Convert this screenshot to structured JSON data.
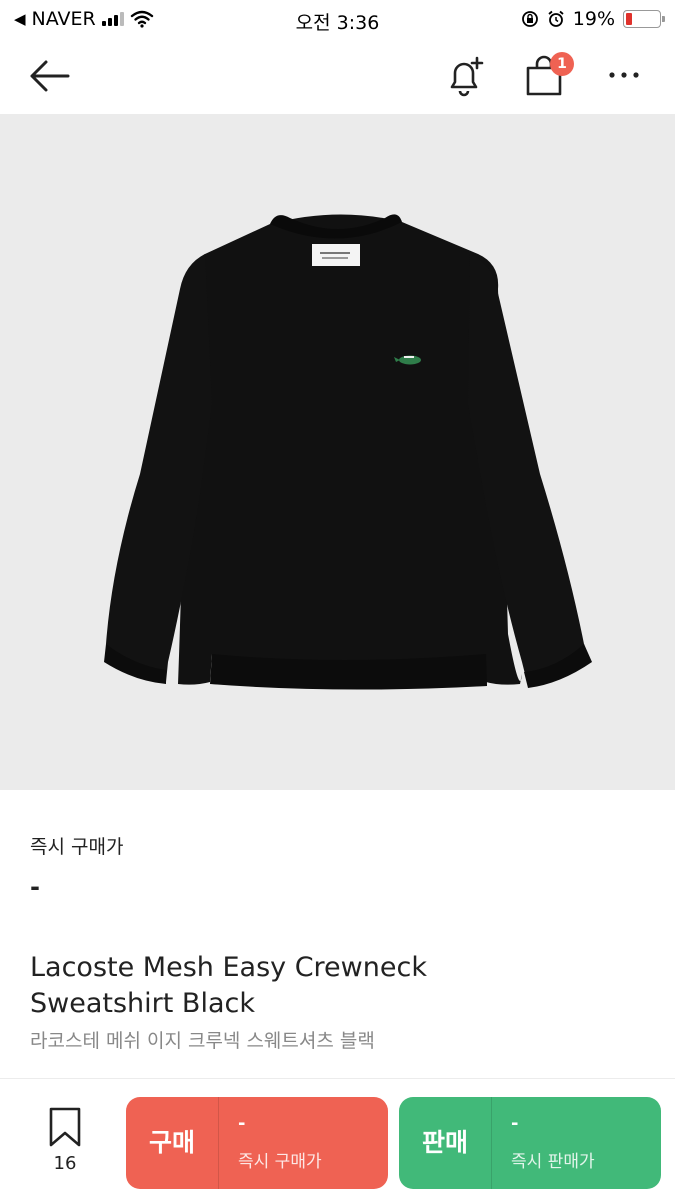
{
  "status_bar": {
    "back_app": "NAVER",
    "time": "오전 3:36",
    "battery": "19%"
  },
  "nav": {
    "back_icon": "arrow-left-icon",
    "bell_icon": "bell-plus-icon",
    "bag_icon": "shopping-bag-icon",
    "cart_count": "1",
    "more_icon": "more-horizontal-icon"
  },
  "product": {
    "image_alt": "black-sweatshirt-image",
    "instant_price_label": "즉시 구매가",
    "instant_price_value": "-",
    "name_en_line1": "Lacoste Mesh Easy Crewneck",
    "name_en_line2": "Sweatshirt Black",
    "name_ko": "라코스테 메쉬 이지 크루넥 스웨트셔츠 블랙"
  },
  "bottom_bar": {
    "wish_count": "16",
    "buy": {
      "label": "구매",
      "price": "-",
      "sub": "즉시 구매가"
    },
    "sell": {
      "label": "판매",
      "price": "-",
      "sub": "즉시 판매가"
    }
  },
  "colors": {
    "buy": "#ef6253",
    "sell": "#41b979",
    "badge": "#ef6253",
    "image_bg": "#ebebeb"
  }
}
